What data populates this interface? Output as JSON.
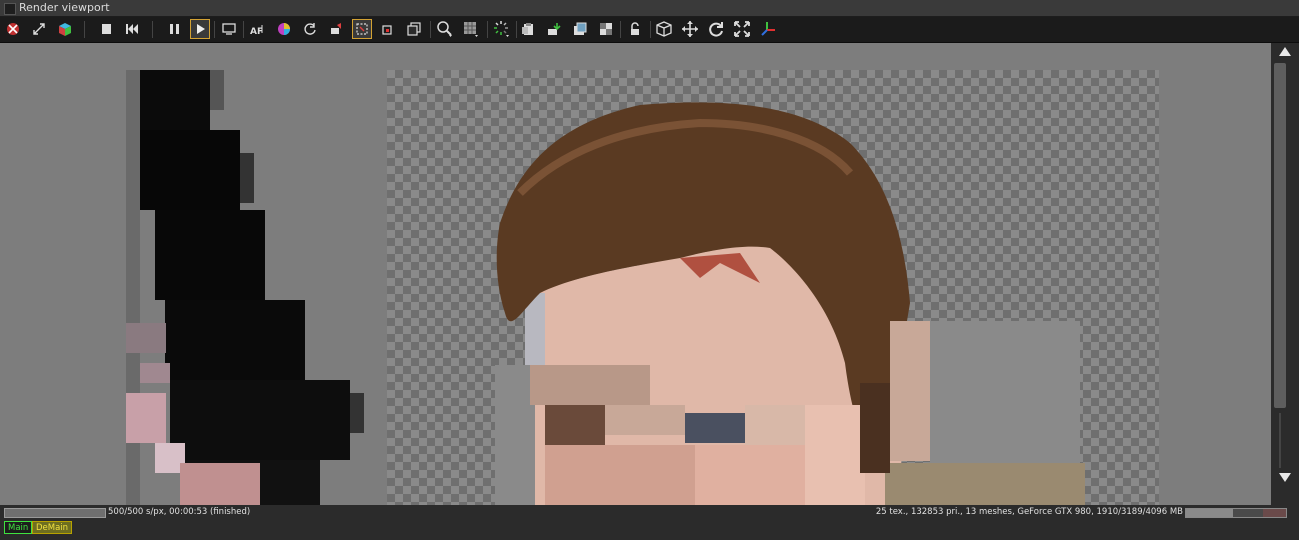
{
  "window": {
    "title": "Render viewport"
  },
  "toolbar": {
    "icons": [
      "clear-cache-icon",
      "resize-icon",
      "cube-color-icon",
      "stop-icon",
      "rewind-icon",
      "pause-icon",
      "play-icon",
      "display-settings-icon",
      "text-af-icon",
      "color-wheel-icon",
      "refresh-icon",
      "camera-lamp-icon",
      "region-pick-icon",
      "focus-pick-icon",
      "copy-image-icon",
      "zoom-icon",
      "grid-icon",
      "spinner-icon",
      "clipboard-icon",
      "import-icon",
      "export-icon",
      "checker-icon",
      "lock-icon",
      "cube-icon",
      "move-icon",
      "rotate-icon",
      "fit-icon",
      "axis-icon"
    ]
  },
  "status": {
    "progress_fraction": 1.0,
    "left_text": "500/500 s/px, 00:00:53 (finished)",
    "right_text": "25 tex., 132853 pri., 13 meshes, GeForce GTX 980, 1910/3189/4096 MB",
    "memory_used_fraction": 0.47,
    "memory_reserved_fraction": 0.78
  },
  "channels": [
    {
      "label": "Main"
    },
    {
      "label": "DeMain"
    }
  ],
  "colors": {
    "accent_active": "#d3a233",
    "viewport_bg": "#7d7d7d",
    "main_chip": "#3fe23f",
    "demain_chip": "#f0e040"
  }
}
